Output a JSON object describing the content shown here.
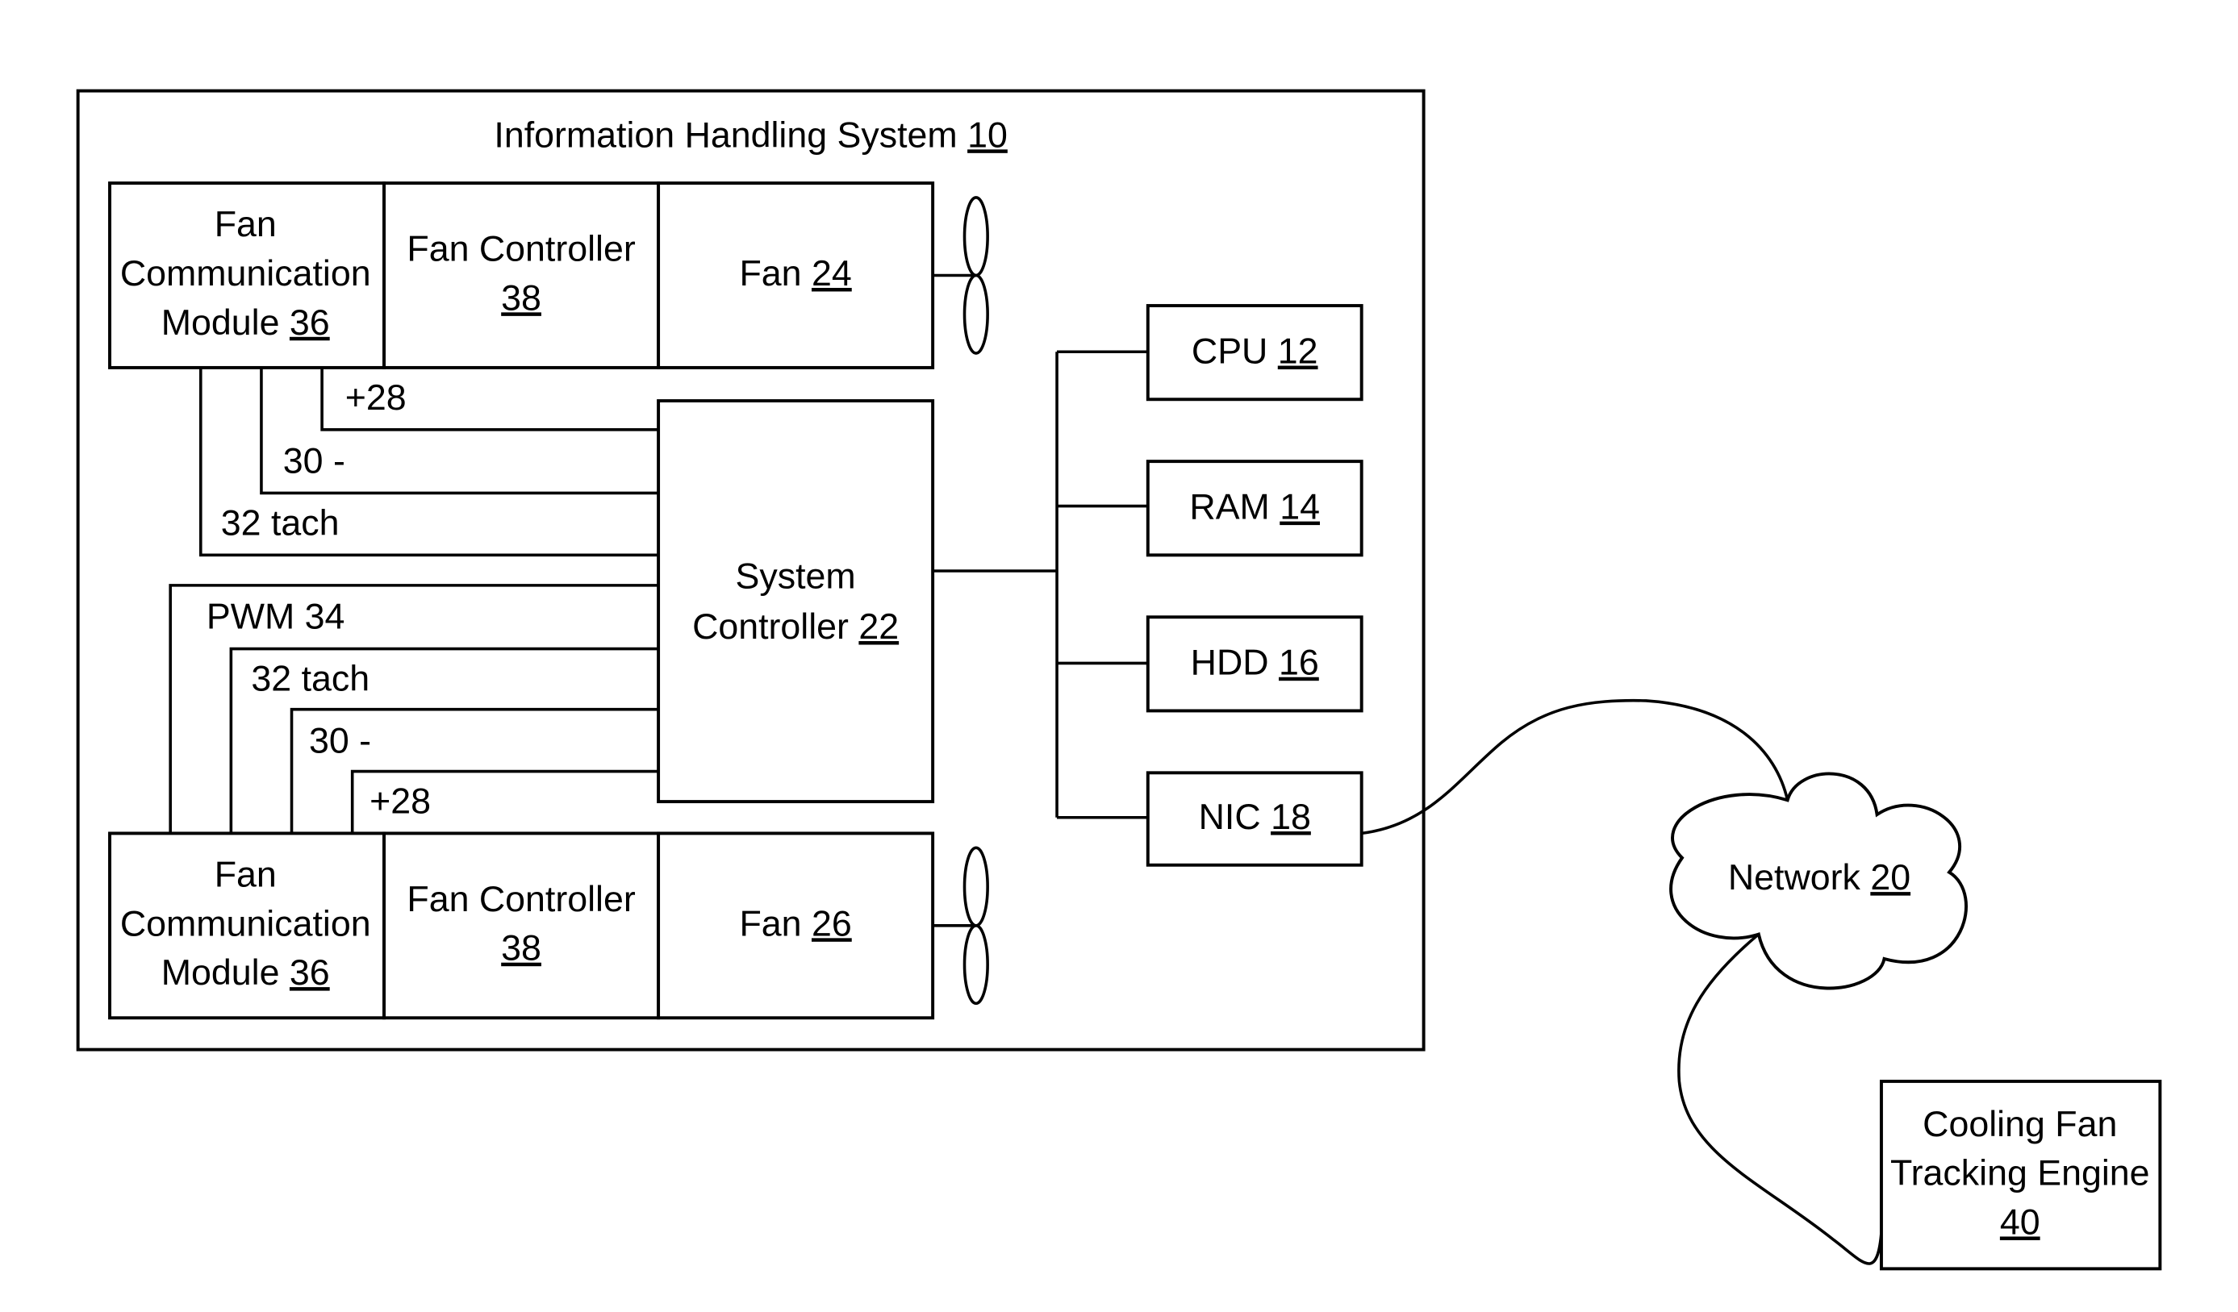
{
  "diagram": {
    "system": {
      "label": "Information Handling System",
      "ref": "10"
    },
    "fan_units": [
      {
        "comm_module": {
          "line1": "Fan",
          "line2": "Communication",
          "line3": "Module",
          "ref": "36"
        },
        "fan_controller": {
          "line1": "Fan Controller",
          "ref": "38"
        },
        "fan": {
          "label": "Fan",
          "ref": "24"
        }
      },
      {
        "comm_module": {
          "line1": "Fan",
          "line2": "Communication",
          "line3": "Module",
          "ref": "36"
        },
        "fan_controller": {
          "line1": "Fan Controller",
          "ref": "38"
        },
        "fan": {
          "label": "Fan",
          "ref": "26"
        }
      }
    ],
    "system_controller": {
      "line1": "System",
      "line2": "Controller",
      "ref": "22"
    },
    "top_wires": [
      {
        "label": "+28"
      },
      {
        "label": "30 -"
      },
      {
        "label": "32 tach"
      }
    ],
    "bottom_wires": [
      {
        "label": "PWM 34"
      },
      {
        "label": "32 tach"
      },
      {
        "label": "30 -"
      },
      {
        "label": "+28"
      }
    ],
    "components": [
      {
        "label": "CPU",
        "ref": "12"
      },
      {
        "label": "RAM",
        "ref": "14"
      },
      {
        "label": "HDD",
        "ref": "16"
      },
      {
        "label": "NIC",
        "ref": "18"
      }
    ],
    "network": {
      "label": "Network",
      "ref": "20"
    },
    "tracking_engine": {
      "line1": "Cooling Fan",
      "line2": "Tracking Engine",
      "ref": "40"
    }
  }
}
